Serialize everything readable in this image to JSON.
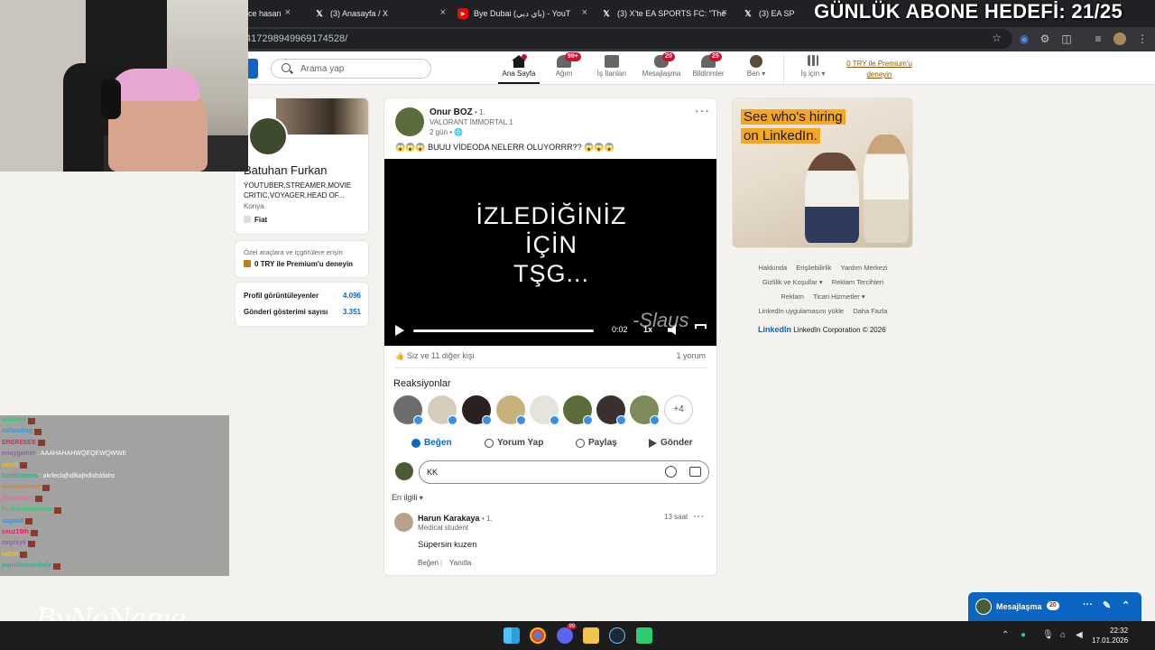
{
  "browser": {
    "tabs": [
      {
        "title": "üce hasan",
        "icon": "youtube-icon"
      },
      {
        "title": "(3) Anasayfa / X",
        "icon": "x-icon"
      },
      {
        "title": "Bye Dubai (باي دبي) - YouT",
        "icon": "youtube-icon"
      },
      {
        "title": "(3) X'te EA SPORTS FC: \"The Xl",
        "icon": "x-icon"
      },
      {
        "title": "(3) EA SP",
        "icon": "x-icon"
      }
    ],
    "url": "417298949969174528/"
  },
  "overlay": {
    "title": "GÜNLÜK ABONE HEDEFİ: 21/25",
    "watermark": "ByNoName",
    "chat": [
      {
        "user": "askinmr",
        "msg": ""
      },
      {
        "user": "rollandrag",
        "msg": ""
      },
      {
        "user": "EREREEEE",
        "msg": ""
      },
      {
        "user": "onaygamer",
        "msg": ": AAAHAHAHWQEQEWQWWE"
      },
      {
        "user": "ceudi",
        "msg": ""
      },
      {
        "user": "hedilizmaya",
        "msg": ": akrfecla|hdlkajhdlsfsldahs"
      },
      {
        "user": "hirviaztheme",
        "msg": ""
      },
      {
        "user": "jhnnywrzn",
        "msg": ""
      },
      {
        "user": "Furkandencheva",
        "msg": ""
      },
      {
        "user": "sagakd",
        "msg": ""
      },
      {
        "user": "ceuz19th",
        "msg": ""
      },
      {
        "user": "oxgrky6",
        "msg": ""
      },
      {
        "user": "iolkt8",
        "msg": ""
      },
      {
        "user": "pipislikertenkele",
        "msg": ""
      }
    ]
  },
  "nav": {
    "search_placeholder": "Arama yap",
    "items": [
      {
        "label": "Ana Sayfa",
        "badge": "",
        "active": true
      },
      {
        "label": "Ağım",
        "badge": "99+"
      },
      {
        "label": "İş İlanları",
        "badge": ""
      },
      {
        "label": "Mesajlaşma",
        "badge": "20"
      },
      {
        "label": "Bildirimler",
        "badge": "25"
      },
      {
        "label": "Ben ▾",
        "badge": ""
      },
      {
        "label": "İş için ▾",
        "badge": ""
      }
    ],
    "premium": "0 TRY ile Premium'u deneyin"
  },
  "profile": {
    "name": "Batuhan Furkan",
    "headline": "YOUTUBER,STREAMER,MOVIE CRITIC,VOYAGER,HEAD OF...",
    "location": "Konya",
    "company": "Fiat",
    "premium_prompt": "Özel araçlara ve içgörülere erişin",
    "premium_cta": "0 TRY ile Premium'u deneyin",
    "stats": [
      {
        "label": "Profil görüntüleyenler",
        "value": "4.096"
      },
      {
        "label": "Gönderi gösterimi sayısı",
        "value": "3.351"
      }
    ]
  },
  "post": {
    "author": "Onur BOZ",
    "degree": "• 1.",
    "author_title": "VALORANT İMMORTAL 1",
    "time": "2 gün • 🌐",
    "text": "😱😱😱 BUUU VİDEODA NELERR OLUYORRR?? 😱😱😱",
    "video": {
      "line1": "İZLEDİĞİNİZ",
      "line2": "İÇİN",
      "line3": "TŞG...",
      "signature": "-Slaus",
      "time": "0:02",
      "speed": "1x",
      "progress": 0.95
    },
    "reactions_text": "Siz ve 11 diğer kişi",
    "comments_text": "1 yorum",
    "reactions_title": "Reaksiyonlar",
    "reactors_more": "+4",
    "actions": {
      "like": "Beğen",
      "comment": "Yorum Yap",
      "share": "Paylaş",
      "send": "Gönder"
    },
    "comment_input": "KK",
    "sort": "En ilgili",
    "comment": {
      "author": "Harun Karakaya",
      "degree": "• 1.",
      "title": "Medical student",
      "time": "13 saat",
      "text": "Süpersin kuzen",
      "like": "Beğen",
      "reply": "Yanıtla"
    }
  },
  "ad": {
    "line1": "See who's hiring",
    "line2": "on LinkedIn."
  },
  "footer": {
    "links": [
      "Hakkında",
      "Erişilebilirlik",
      "Yardım Merkezi",
      "Gizlilik ve Koşullar ▾",
      "Reklam Tercihleri",
      "Reklam",
      "Ticari Hizmetler ▾",
      "LinkedIn uygulamasını yükle",
      "Daha Fazla"
    ],
    "brand": "LinkedIn",
    "copyright": "LinkedIn Corporation © 2026"
  },
  "messaging": {
    "label": "Mesajlaşma",
    "badge": "20"
  },
  "taskbar": {
    "time": "22:32",
    "date": "17.01.2026",
    "discord_badge": "99"
  }
}
